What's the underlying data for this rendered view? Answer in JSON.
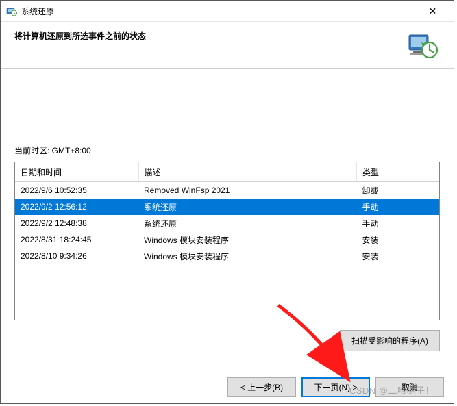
{
  "window": {
    "title": "系统还原",
    "close_glyph": "✕"
  },
  "header": {
    "heading": "将计算机还原到所选事件之前的状态"
  },
  "timezone_label": "当前时区: GMT+8:00",
  "table": {
    "columns": {
      "date": "日期和时间",
      "desc": "描述",
      "type": "类型"
    },
    "rows": [
      {
        "date": "2022/9/6 10:52:35",
        "desc": "Removed WinFsp 2021",
        "type": "卸载",
        "selected": false
      },
      {
        "date": "2022/9/2 12:56:12",
        "desc": "系统还原",
        "type": "手动",
        "selected": true
      },
      {
        "date": "2022/9/2 12:48:38",
        "desc": "系统还原",
        "type": "手动",
        "selected": false
      },
      {
        "date": "2022/8/31 18:24:45",
        "desc": "Windows 模块安装程序",
        "type": "安装",
        "selected": false
      },
      {
        "date": "2022/8/10 9:34:26",
        "desc": "Windows 模块安装程序",
        "type": "安装",
        "selected": false
      }
    ]
  },
  "buttons": {
    "scan_affected": "扫描受影响的程序(A)",
    "back": "< 上一步(B)",
    "next": "下一页(N) >",
    "cancel": "取消"
  },
  "watermark": "CSDN @二哈喇子！"
}
